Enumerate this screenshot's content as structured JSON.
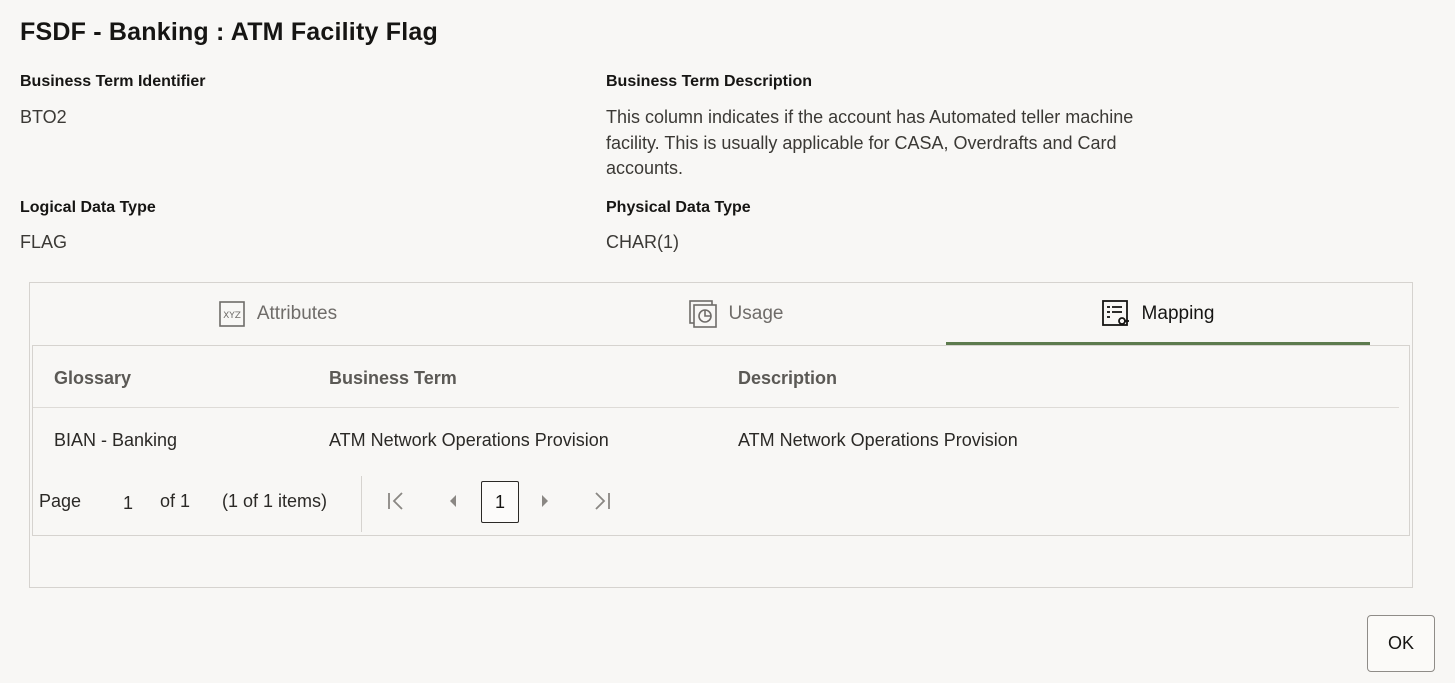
{
  "dialog": {
    "title": "FSDF - Banking : ATM Facility Flag"
  },
  "fields": {
    "business_term_identifier": {
      "label": "Business Term Identifier",
      "value": "BTO2"
    },
    "business_term_description": {
      "label": "Business Term Description",
      "value": "This column indicates if the account has Automated teller machine facility. This is usually applicable for CASA, Overdrafts and Card accounts."
    },
    "logical_data_type": {
      "label": "Logical Data Type",
      "value": "FLAG"
    },
    "physical_data_type": {
      "label": "Physical Data Type",
      "value": "CHAR(1)"
    }
  },
  "tabs": [
    {
      "label": "Attributes",
      "icon": "xyz-attributes-icon",
      "active": false
    },
    {
      "label": "Usage",
      "icon": "usage-icon",
      "active": false
    },
    {
      "label": "Mapping",
      "icon": "mapping-icon",
      "active": true
    }
  ],
  "table": {
    "columns": [
      "Glossary",
      "Business Term",
      "Description"
    ],
    "rows": [
      [
        "BIAN - Banking",
        "ATM Network Operations Provision",
        "ATM Network Operations Provision"
      ]
    ]
  },
  "pager": {
    "page_label": "Page",
    "page_value": "1",
    "of_label": "of 1",
    "items_label": "(1 of 1 items)",
    "current_page": "1"
  },
  "footer": {
    "ok_label": "OK"
  },
  "colors": {
    "active_tab_underline": "#5d7b4e",
    "background": "#f8f7f5"
  }
}
